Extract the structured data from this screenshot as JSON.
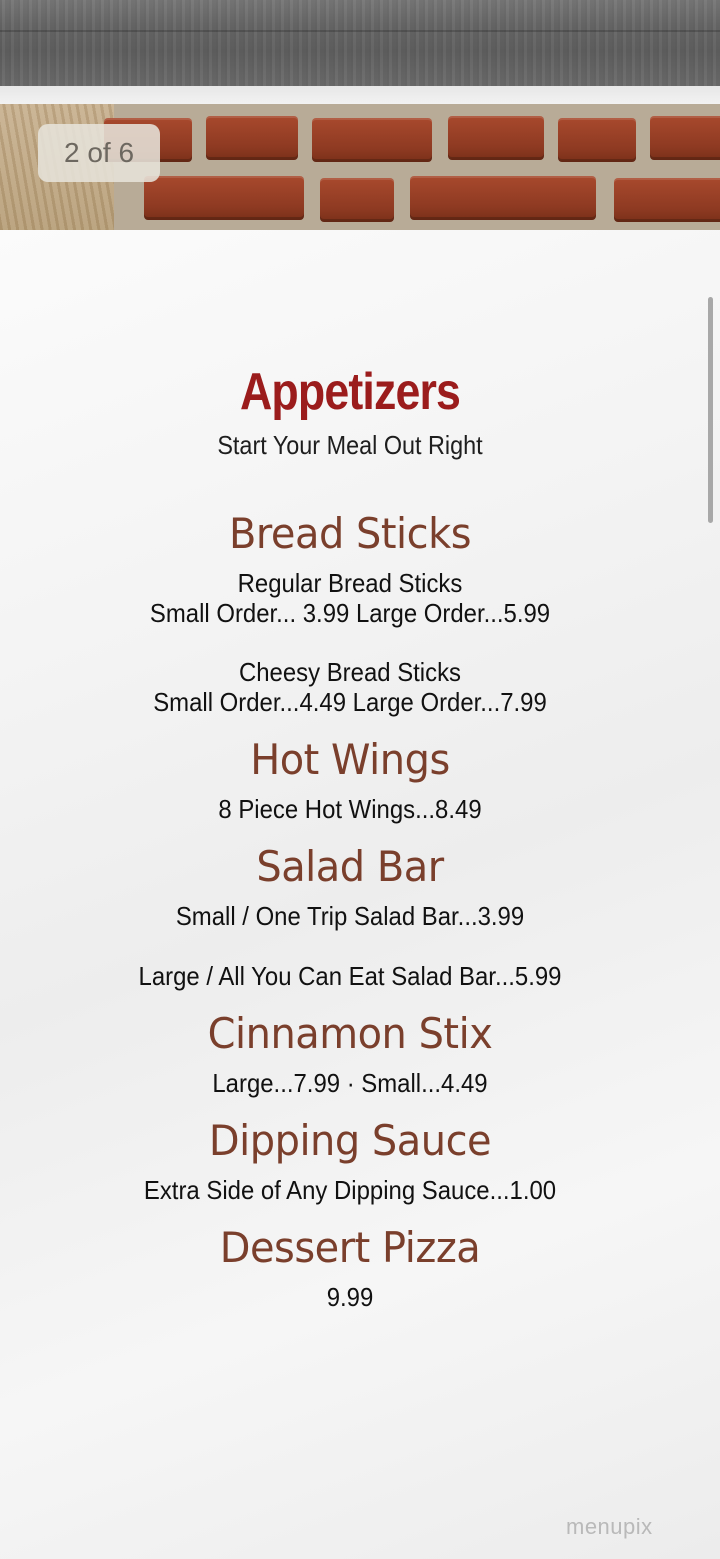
{
  "header": {
    "page_indicator": "2 of 6"
  },
  "menu": {
    "title": "Appetizers",
    "subtitle": "Start Your Meal Out Right",
    "sections": [
      {
        "name": "Bread Sticks",
        "lines": [
          "Regular Bread Sticks",
          "Small Order... 3.99   Large Order...5.99",
          "Cheesy Bread Sticks",
          "Small Order...4.49   Large Order...7.99"
        ]
      },
      {
        "name": "Hot Wings",
        "lines": [
          "8 Piece Hot Wings...8.49"
        ]
      },
      {
        "name": "Salad Bar",
        "lines": [
          "Small / One Trip Salad Bar...3.99",
          "Large / All You Can Eat Salad Bar...5.99"
        ]
      },
      {
        "name": "Cinnamon Stix",
        "lines": [
          "Large...7.99  ·  Small...4.49"
        ]
      },
      {
        "name": "Dipping Sauce",
        "lines": [
          "Extra Side of Any Dipping Sauce...1.00"
        ]
      },
      {
        "name": "Dessert Pizza",
        "lines": [
          "9.99"
        ]
      }
    ]
  },
  "watermark": "menupix",
  "colors": {
    "title": "#9b1c1c",
    "section": "#7a3f2c",
    "text": "#111111"
  }
}
